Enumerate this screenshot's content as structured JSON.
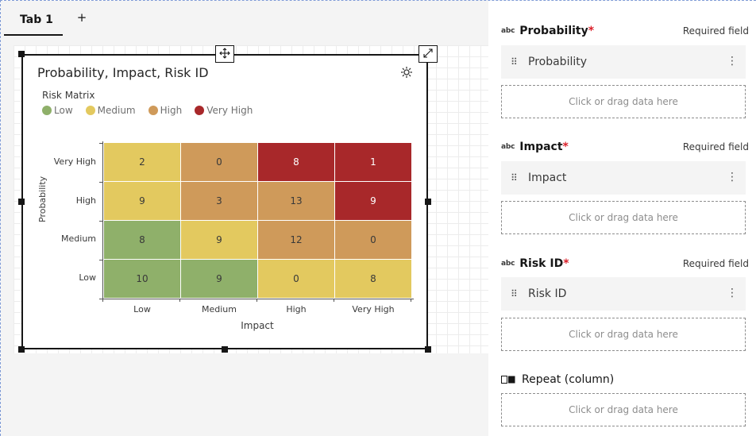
{
  "tabs": {
    "items": [
      {
        "label": "Tab 1"
      }
    ],
    "add_label": "+"
  },
  "widget": {
    "title": "Probability, Impact, Risk ID",
    "legend_title": "Risk Matrix",
    "legend": [
      {
        "label": "Low",
        "color": "#8fb06a"
      },
      {
        "label": "Medium",
        "color": "#e3c95f"
      },
      {
        "label": "High",
        "color": "#cf9a5a"
      },
      {
        "label": "Very High",
        "color": "#a8282a"
      }
    ],
    "icons": [
      "move-icon",
      "expand-icon",
      "settings-icon"
    ]
  },
  "chart_data": {
    "type": "heatmap",
    "title": "Probability, Impact, Risk ID",
    "xlabel": "Impact",
    "ylabel": "Probability",
    "x_categories": [
      "Low",
      "Medium",
      "High",
      "Very High"
    ],
    "y_categories": [
      "Very High",
      "High",
      "Medium",
      "Low"
    ],
    "cells": [
      [
        {
          "value": 2,
          "level": "Medium"
        },
        {
          "value": 0,
          "level": "High"
        },
        {
          "value": 8,
          "level": "Very High"
        },
        {
          "value": 1,
          "level": "Very High"
        }
      ],
      [
        {
          "value": 9,
          "level": "Medium"
        },
        {
          "value": 3,
          "level": "High"
        },
        {
          "value": 13,
          "level": "High"
        },
        {
          "value": 9,
          "level": "Very High"
        }
      ],
      [
        {
          "value": 8,
          "level": "Low"
        },
        {
          "value": 9,
          "level": "Medium"
        },
        {
          "value": 12,
          "level": "High"
        },
        {
          "value": 0,
          "level": "High"
        }
      ],
      [
        {
          "value": 10,
          "level": "Low"
        },
        {
          "value": 9,
          "level": "Low"
        },
        {
          "value": 0,
          "level": "Medium"
        },
        {
          "value": 8,
          "level": "Medium"
        }
      ]
    ],
    "level_colors": {
      "Low": "#8fb06a",
      "Medium": "#e3c95f",
      "High": "#cf9a5a",
      "Very High": "#a8282a"
    },
    "legend": [
      "Low",
      "Medium",
      "High",
      "Very High"
    ],
    "legend_title": "Risk Matrix",
    "legend_placement": "top-left"
  },
  "fields": [
    {
      "type_icon": "abc",
      "name": "Probability",
      "required": true,
      "required_text": "Required field",
      "item": "Probability",
      "drop_placeholder": "Click or drag data here"
    },
    {
      "type_icon": "abc",
      "name": "Impact",
      "required": true,
      "required_text": "Required field",
      "item": "Impact",
      "drop_placeholder": "Click or drag data here"
    },
    {
      "type_icon": "abc",
      "name": "Risk ID",
      "required": true,
      "required_text": "Required field",
      "item": "Risk ID",
      "drop_placeholder": "Click or drag data here"
    }
  ],
  "repeat": {
    "label": "Repeat (column)",
    "drop_placeholder": "Click or drag data here"
  }
}
